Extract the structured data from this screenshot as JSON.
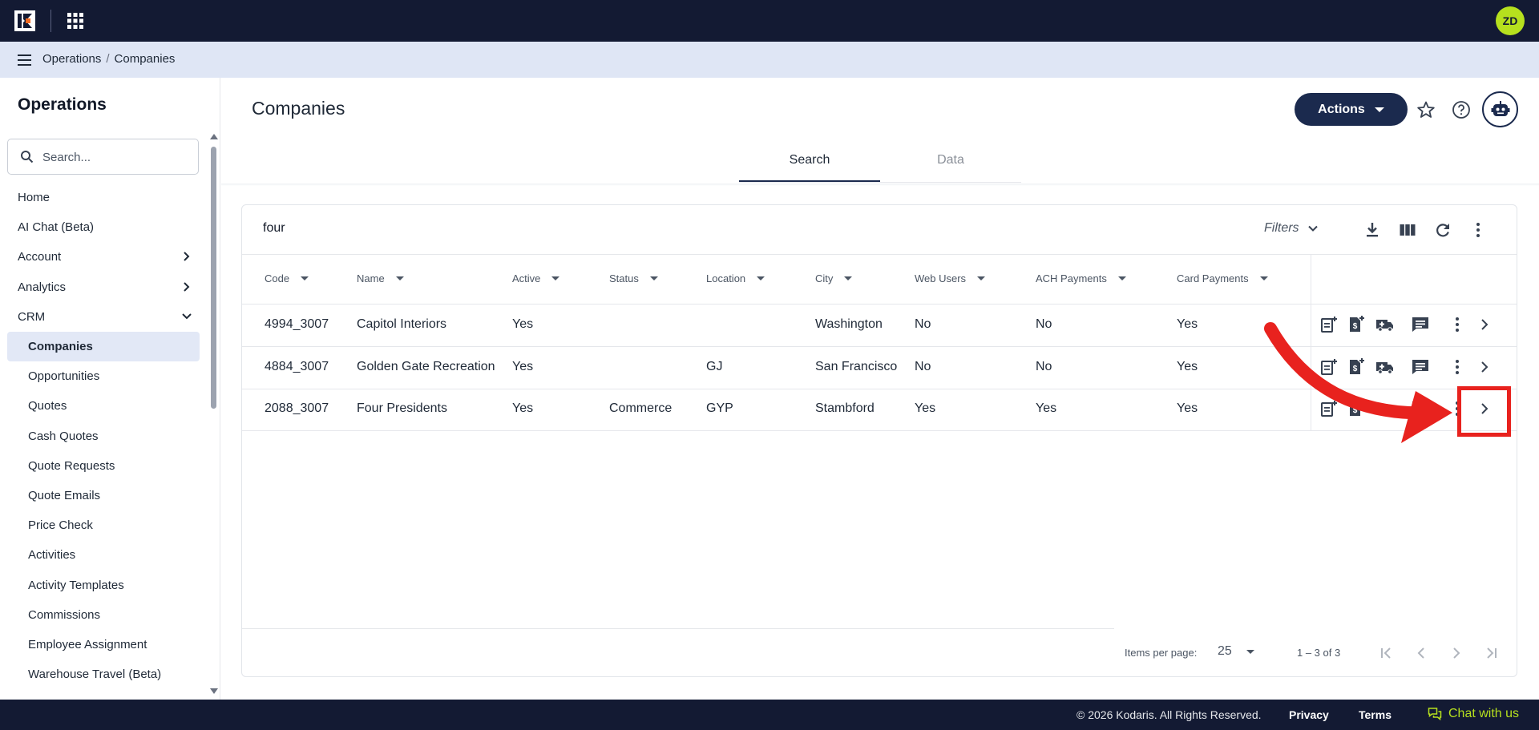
{
  "header": {
    "avatar_initials": "ZD"
  },
  "breadcrumb": {
    "items": [
      "Operations",
      "Companies"
    ],
    "separator": "/"
  },
  "sidebar": {
    "title": "Operations",
    "search_placeholder": "Search...",
    "items": [
      {
        "label": "Home",
        "level": 0,
        "expand": "none"
      },
      {
        "label": "AI Chat (Beta)",
        "level": 0,
        "expand": "none"
      },
      {
        "label": "Account",
        "level": 0,
        "expand": "right"
      },
      {
        "label": "Analytics",
        "level": 0,
        "expand": "right"
      },
      {
        "label": "CRM",
        "level": 0,
        "expand": "down"
      },
      {
        "label": "Companies",
        "level": 1,
        "active": true
      },
      {
        "label": "Opportunities",
        "level": 1
      },
      {
        "label": "Quotes",
        "level": 1
      },
      {
        "label": "Cash Quotes",
        "level": 1
      },
      {
        "label": "Quote Requests",
        "level": 1
      },
      {
        "label": "Quote Emails",
        "level": 1
      },
      {
        "label": "Price Check",
        "level": 1
      },
      {
        "label": "Activities",
        "level": 1
      },
      {
        "label": "Activity Templates",
        "level": 1
      },
      {
        "label": "Commissions",
        "level": 1
      },
      {
        "label": "Employee Assignment",
        "level": 1
      },
      {
        "label": "Warehouse Travel (Beta)",
        "level": 1
      }
    ]
  },
  "page": {
    "title": "Companies",
    "actions_label": "Actions",
    "tabs": [
      {
        "label": "Search",
        "active": true
      },
      {
        "label": "Data",
        "active": false
      }
    ]
  },
  "search": {
    "query": "four",
    "filters_label": "Filters"
  },
  "table": {
    "columns": [
      "Code",
      "Name",
      "Active",
      "Status",
      "Location",
      "City",
      "Web Users",
      "ACH Payments",
      "Card Payments"
    ],
    "rows": [
      [
        "4994_3007",
        "Capitol Interiors",
        "Yes",
        "",
        "",
        "Washington",
        "No",
        "No",
        "Yes"
      ],
      [
        "4884_3007",
        "Golden Gate Recreation",
        "Yes",
        "",
        "GJ",
        "San Francisco",
        "No",
        "No",
        "Yes"
      ],
      [
        "2088_3007",
        "Four Presidents",
        "Yes",
        "Commerce",
        "GYP",
        "Stambford",
        "Yes",
        "Yes",
        "Yes"
      ]
    ]
  },
  "pager": {
    "items_per_page_label": "Items per page:",
    "page_size": "25",
    "range": "1 – 3 of 3"
  },
  "footer": {
    "copyright": "© 2026 Kodaris. All Rights Reserved.",
    "privacy": "Privacy",
    "terms": "Terms",
    "chat": "Chat with us"
  },
  "colors": {
    "topbar": "#131a33",
    "accent": "#b6e01e",
    "primary_button": "#1b2a4e",
    "annotation": "#e8221e"
  }
}
